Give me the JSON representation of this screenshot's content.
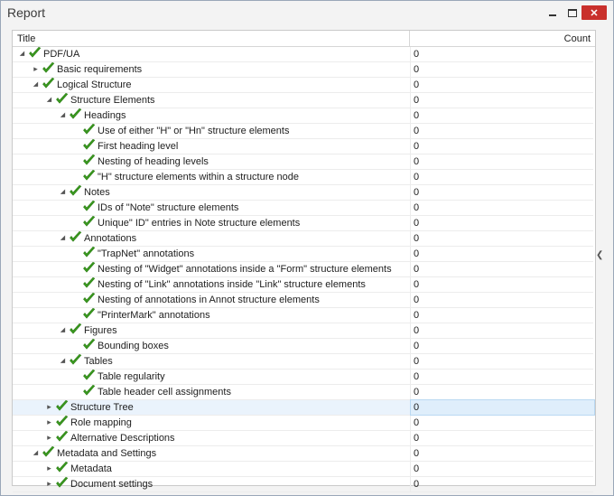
{
  "window": {
    "title": "Report",
    "close_label": "✕"
  },
  "columns": {
    "title": "Title",
    "count": "Count"
  },
  "rows": [
    {
      "label": "PDF/UA",
      "count": "0",
      "level": 0,
      "state": "expanded"
    },
    {
      "label": "Basic requirements",
      "count": "0",
      "level": 1,
      "state": "collapsed"
    },
    {
      "label": "Logical Structure",
      "count": "0",
      "level": 1,
      "state": "expanded"
    },
    {
      "label": "Structure Elements",
      "count": "0",
      "level": 2,
      "state": "expanded"
    },
    {
      "label": "Headings",
      "count": "0",
      "level": 3,
      "state": "expanded"
    },
    {
      "label": "Use of either \"H\" or \"Hn\" structure elements",
      "count": "0",
      "level": 4,
      "state": "leaf"
    },
    {
      "label": "First heading level",
      "count": "0",
      "level": 4,
      "state": "leaf"
    },
    {
      "label": "Nesting of heading levels",
      "count": "0",
      "level": 4,
      "state": "leaf"
    },
    {
      "label": "\"H\" structure elements within a structure node",
      "count": "0",
      "level": 4,
      "state": "leaf"
    },
    {
      "label": "Notes",
      "count": "0",
      "level": 3,
      "state": "expanded"
    },
    {
      "label": "IDs of \"Note\" structure elements",
      "count": "0",
      "level": 4,
      "state": "leaf"
    },
    {
      "label": "Unique\" ID\" entries in Note structure elements",
      "count": "0",
      "level": 4,
      "state": "leaf"
    },
    {
      "label": "Annotations",
      "count": "0",
      "level": 3,
      "state": "expanded"
    },
    {
      "label": "\"TrapNet\" annotations",
      "count": "0",
      "level": 4,
      "state": "leaf"
    },
    {
      "label": "Nesting of \"Widget\" annotations inside a \"Form\" structure elements",
      "count": "0",
      "level": 4,
      "state": "leaf"
    },
    {
      "label": "Nesting of \"Link\" annotations inside \"Link\" structure elements",
      "count": "0",
      "level": 4,
      "state": "leaf"
    },
    {
      "label": "Nesting of annotations in Annot structure elements",
      "count": "0",
      "level": 4,
      "state": "leaf"
    },
    {
      "label": "\"PrinterMark\" annotations",
      "count": "0",
      "level": 4,
      "state": "leaf"
    },
    {
      "label": "Figures",
      "count": "0",
      "level": 3,
      "state": "expanded"
    },
    {
      "label": "Bounding boxes",
      "count": "0",
      "level": 4,
      "state": "leaf"
    },
    {
      "label": "Tables",
      "count": "0",
      "level": 3,
      "state": "expanded"
    },
    {
      "label": "Table regularity",
      "count": "0",
      "level": 4,
      "state": "leaf"
    },
    {
      "label": "Table header cell assignments",
      "count": "0",
      "level": 4,
      "state": "leaf"
    },
    {
      "label": "Structure Tree",
      "count": "0",
      "level": 2,
      "state": "collapsed",
      "selected": true
    },
    {
      "label": "Role mapping",
      "count": "0",
      "level": 2,
      "state": "collapsed"
    },
    {
      "label": "Alternative Descriptions",
      "count": "0",
      "level": 2,
      "state": "collapsed"
    },
    {
      "label": "Metadata and Settings",
      "count": "0",
      "level": 1,
      "state": "expanded"
    },
    {
      "label": "Metadata",
      "count": "0",
      "level": 2,
      "state": "collapsed"
    },
    {
      "label": "Document settings",
      "count": "0",
      "level": 2,
      "state": "collapsed"
    }
  ],
  "colors": {
    "check": "#3a9a1f",
    "close_bg": "#c9302c",
    "selection": "#dfeefb"
  },
  "icons": {
    "check": "checkmark-icon",
    "expanded": "triangle-down-icon",
    "collapsed": "triangle-right-icon",
    "side": "chevron-left-icon"
  }
}
